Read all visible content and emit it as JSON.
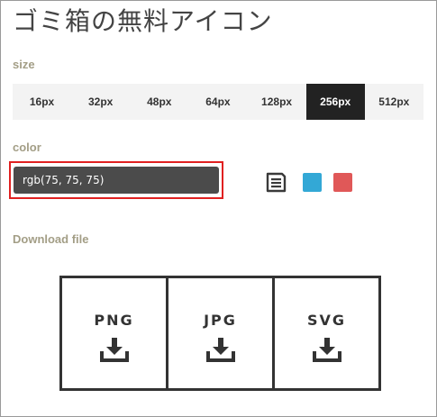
{
  "page_title": "ゴミ箱の無料アイコン",
  "size": {
    "label": "size",
    "options": [
      "16px",
      "32px",
      "48px",
      "64px",
      "128px",
      "256px",
      "512px"
    ],
    "selected": "256px"
  },
  "color": {
    "label": "color",
    "value": "rgb(75, 75, 75)",
    "save_icon": "save-icon",
    "swatches": [
      {
        "name": "blue-swatch",
        "color": "#33a8d6"
      },
      {
        "name": "red-swatch",
        "color": "#e05858"
      }
    ]
  },
  "download": {
    "label": "Download file",
    "formats": [
      "PNG",
      "JPG",
      "SVG"
    ],
    "icon": "download-icon"
  },
  "colors": {
    "accent_border": "#e02020",
    "input_bg": "#4b4b4b",
    "label_color": "#a39e86"
  }
}
